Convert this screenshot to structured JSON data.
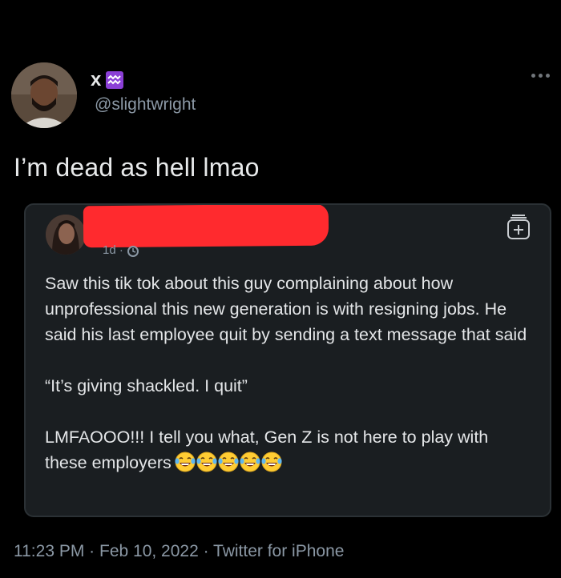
{
  "author": {
    "display_name": "x",
    "name_emoji": "aquarius-icon",
    "handle": "@slightwright"
  },
  "tweet": {
    "text": "I’m dead as hell lmao",
    "timestamp": "11:23 PM · Feb 10, 2022 · Twitter for iPhone"
  },
  "embedded_post": {
    "time": "1d ·",
    "paragraphs": [
      "Saw this tik tok about this guy complaining about how unprofessional this new generation is with resigning jobs. He said his last employee quit by sending a text message that said",
      "“It’s giving shackled. I quit”",
      "LMFAOOO!!! I tell you what, Gen Z is not here to play with these employers"
    ],
    "emoji_count": 5,
    "emoji_name": "face-with-tears-of-joy-icon"
  },
  "colors": {
    "background": "#000000",
    "text": "#e7e9ea",
    "secondary": "#8b98a5",
    "card_bg": "#1a1e21",
    "redaction": "#ff2a2e",
    "aquarius_badge": "#8b3fd6"
  }
}
